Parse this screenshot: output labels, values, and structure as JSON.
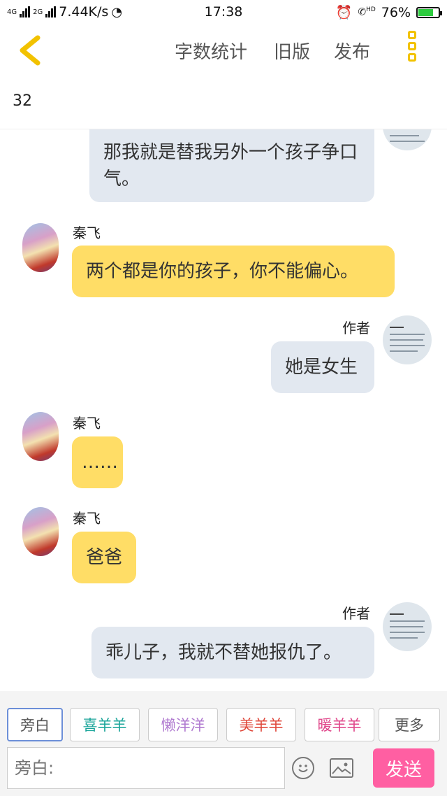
{
  "status": {
    "net1": "4G",
    "net2": "2G",
    "speed": "7.44K/s",
    "time": "17:38",
    "hd": "HD",
    "battery": "76%",
    "battery_level": 0.76
  },
  "toolbar": {
    "back_icon": "chevron-left-icon",
    "word_count_label": "字数统计",
    "old_version_label": "旧版",
    "publish_label": "发布",
    "menu_icon": "more-vertical-icon"
  },
  "word_count": "32",
  "messages": [
    {
      "side": "right",
      "speaker": "",
      "text": "那我就是替我另外一个孩子争口气。",
      "color": "#e2e8f0"
    },
    {
      "side": "left",
      "speaker": "秦飞",
      "text": "两个都是你的孩子，你不能偏心。",
      "color": "#ffdd66"
    },
    {
      "side": "right",
      "speaker": "作者",
      "text": "她是女生",
      "color": "#e2e8f0"
    },
    {
      "side": "left",
      "speaker": "秦飞",
      "text": "……",
      "color": "#ffdd66"
    },
    {
      "side": "left",
      "speaker": "秦飞",
      "text": "爸爸",
      "color": "#ffdd66"
    },
    {
      "side": "right",
      "speaker": "作者",
      "text": "乖儿子，我就不替她报仇了。",
      "color": "#e2e8f0"
    }
  ],
  "roles": [
    {
      "label": "旁白",
      "color": "#555555"
    },
    {
      "label": "喜羊羊",
      "color": "#1aa59a"
    },
    {
      "label": "懒洋洋",
      "color": "#b07ad0"
    },
    {
      "label": "美羊羊",
      "color": "#e0483b"
    },
    {
      "label": "暖羊羊",
      "color": "#e0488b"
    },
    {
      "label": "更多",
      "color": "#555555"
    }
  ],
  "input": {
    "placeholder": "旁白:"
  },
  "send_label": "发送",
  "icons": {
    "emoji": "smiley-icon",
    "image": "image-icon"
  }
}
